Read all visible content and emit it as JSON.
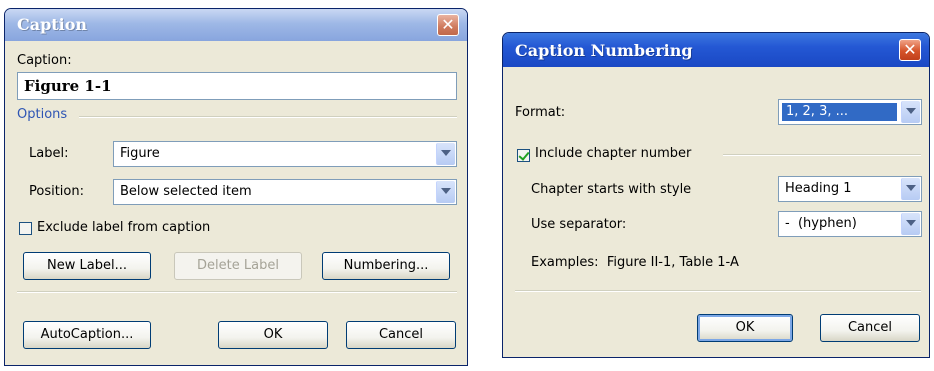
{
  "caption_dialog": {
    "title": "Caption",
    "caption_label": "Caption:",
    "caption_value": "Figure 1-1",
    "options_title": "Options",
    "label_label": "Label:",
    "label_value": "Figure",
    "position_label": "Position:",
    "position_value": "Below selected item",
    "exclude_label": "Exclude label from caption",
    "exclude_checked": false,
    "new_label_button": "New Label...",
    "delete_label_button": "Delete Label",
    "numbering_button": "Numbering...",
    "autocaption_button": "AutoCaption...",
    "ok_button": "OK",
    "cancel_button": "Cancel"
  },
  "numbering_dialog": {
    "title": "Caption Numbering",
    "format_label": "Format:",
    "format_value": "1, 2, 3, ...",
    "include_chapter_label": "Include chapter number",
    "include_chapter_checked": true,
    "chapter_style_label": "Chapter starts with style",
    "chapter_style_value": "Heading 1",
    "separator_label": "Use separator:",
    "separator_value": "-  (hyphen)",
    "examples_text": "Examples:  Figure II-1, Table 1-A",
    "ok_button": "OK",
    "cancel_button": "Cancel"
  },
  "colors": {
    "dialog_bg": "#ece9d8",
    "active_title": "#2458d4",
    "inactive_title": "#9eb8e6",
    "section_title": "#2e55b4",
    "selection": "#316ac5"
  }
}
